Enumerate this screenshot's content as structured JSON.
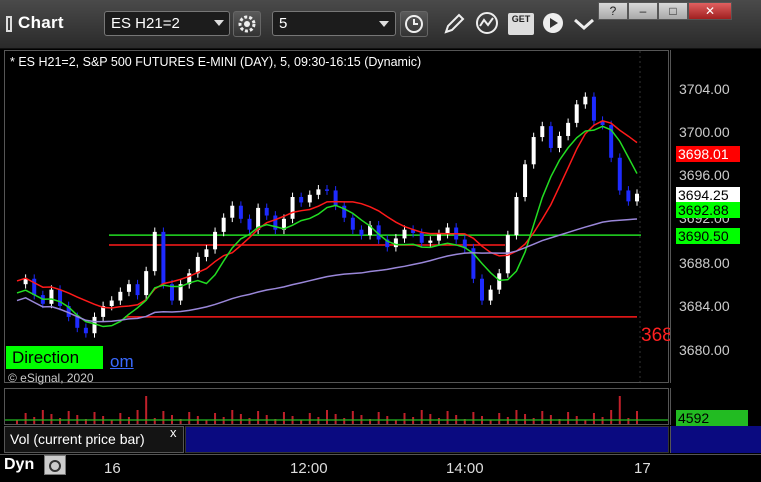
{
  "toolbar": {
    "title": "Chart",
    "symbol": "ES H21=2",
    "interval": "5",
    "get_label": "GET"
  },
  "window_buttons": [
    "?",
    "–",
    "□",
    "✕"
  ],
  "chart": {
    "info": "* ES H21=2, S&P 500 FUTURES E-MINI (DAY), 5, 09:30-16:15 (Dynamic)",
    "direction_label": "Direction",
    "copyright": "© eSignal, 2020",
    "partial_link": "om",
    "hl_label": "368",
    "price_ticks": [
      "3704.00",
      "3700.00",
      "3696.00",
      "3692.00",
      "3688.00",
      "3684.00",
      "3680.00"
    ],
    "price_tags": [
      {
        "value": "3698.01",
        "bg": "#ff0000",
        "fg": "#ffffff"
      },
      {
        "value": "3694.25",
        "bg": "#ffffff",
        "fg": "#000000"
      },
      {
        "value": "3692.88",
        "bg": "#00ff00",
        "fg": "#000000"
      },
      {
        "value": "3690.50",
        "bg": "#00ff00",
        "fg": "#000000"
      }
    ],
    "time_ticks": [
      "16",
      "12:00",
      "14:00",
      "17"
    ],
    "colors": {
      "bull": "#ffffff",
      "bear": "#1e2bff",
      "red_ma": "#ff1a1a",
      "green_ma": "#22dd22",
      "purple_ma": "#9a87d9",
      "support": "#22dd22",
      "resistance": "#ff1a1a"
    }
  },
  "volume": {
    "label": "Vol (current price bar)",
    "close": "x",
    "value": "4592"
  },
  "footer": {
    "label": "Dyn"
  }
}
